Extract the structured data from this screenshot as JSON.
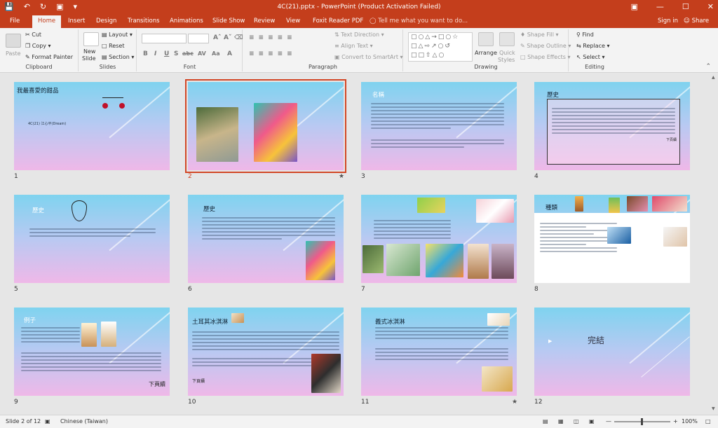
{
  "titlebar": {
    "title": "4C(21).pptx - PowerPoint (Product Activation Failed)",
    "restore_icon": "restore-icon",
    "minimize": "—",
    "maximize": "☐",
    "close": "✕"
  },
  "tabs": [
    {
      "label": "File",
      "active": false
    },
    {
      "label": "Home",
      "active": true
    },
    {
      "label": "Insert",
      "active": false
    },
    {
      "label": "Design",
      "active": false
    },
    {
      "label": "Transitions",
      "active": false
    },
    {
      "label": "Animations",
      "active": false
    },
    {
      "label": "Slide Show",
      "active": false
    },
    {
      "label": "Review",
      "active": false
    },
    {
      "label": "View",
      "active": false
    },
    {
      "label": "Foxit Reader PDF",
      "active": false
    }
  ],
  "tell_me": "Tell me what you want to do...",
  "sign_in": "Sign in",
  "share": "Share",
  "ribbon": {
    "clipboard": {
      "label": "Clipboard",
      "paste": "Paste",
      "cut": "Cut",
      "copy": "Copy",
      "format_painter": "Format Painter"
    },
    "slides": {
      "label": "Slides",
      "new_slide": "New",
      "new_slide2": "Slide",
      "layout": "Layout",
      "reset": "Reset",
      "section": "Section"
    },
    "font": {
      "label": "Font",
      "bold": "B",
      "italic": "I",
      "underline": "U",
      "strike": "S",
      "shadow": "abc",
      "spacing": "AV",
      "case": "Aa",
      "color": "A"
    },
    "paragraph": {
      "label": "Paragraph",
      "text_direction": "Text Direction",
      "align_text": "Align Text",
      "convert_smartart": "Convert to SmartArt"
    },
    "drawing": {
      "label": "Drawing",
      "arrange": "Arrange",
      "quick_styles": "Quick",
      "quick_styles2": "Styles",
      "shape_fill": "Shape Fill",
      "shape_outline": "Shape Outline",
      "shape_effects": "Shape Effects"
    },
    "editing": {
      "label": "Editing",
      "find": "Find",
      "replace": "Replace",
      "select": "Select"
    }
  },
  "slides": [
    {
      "num": "1",
      "title": "我最喜愛的甜品",
      "bullet": "4C(21) 江心平(Dream)"
    },
    {
      "num": "2",
      "title": ""
    },
    {
      "num": "3",
      "title": "名稱"
    },
    {
      "num": "4",
      "title": "歷史",
      "caption": "下頁續"
    },
    {
      "num": "5",
      "title": "歷史"
    },
    {
      "num": "6",
      "title": "歷史"
    },
    {
      "num": "7",
      "title": ""
    },
    {
      "num": "8",
      "title": "種類"
    },
    {
      "num": "9",
      "title": "例子",
      "caption": "下頁續"
    },
    {
      "num": "10",
      "title": "土耳其冰淇淋",
      "caption": "下頁續"
    },
    {
      "num": "11",
      "title": "義式冰淇淋"
    },
    {
      "num": "12",
      "title": "完結"
    }
  ],
  "status": {
    "slide_of": "Slide 2 of 12",
    "language": "Chinese (Taiwan)",
    "zoom": "100%"
  }
}
